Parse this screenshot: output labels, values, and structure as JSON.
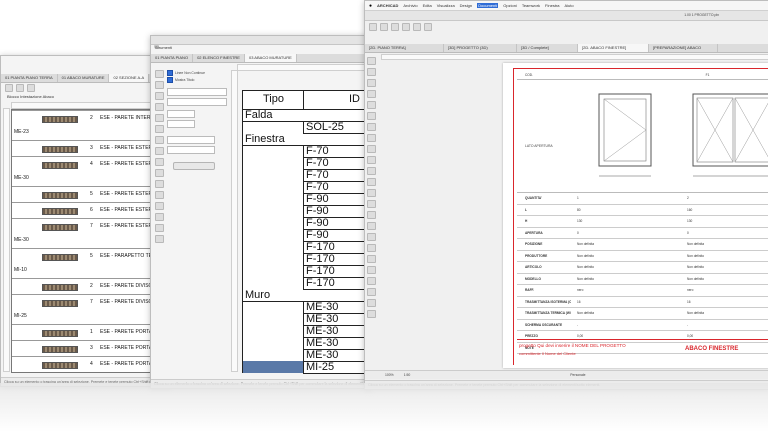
{
  "left_window": {
    "tabs": [
      "01 PIANTA PIANO TERRA",
      "01 ABACO MURATURE",
      "02 SEZIONE A-A"
    ],
    "panel_title": "Blocco Intestazione Abaco",
    "groups": [
      {
        "code": "",
        "rows": [
          {
            "num": "2",
            "text": "ESE - PARETE INTERI"
          }
        ]
      },
      {
        "code": "ME-23",
        "rows": [
          {
            "num": "3",
            "text": "ESE - PARETE ESTER"
          },
          {
            "num": "4",
            "text": "ESE - PARETE ESTER"
          }
        ]
      },
      {
        "code": "ME-30",
        "rows": [
          {
            "num": "5",
            "text": "ESE - PARETE ESTER"
          },
          {
            "num": "6",
            "text": "ESE - PARETE ESTER"
          },
          {
            "num": "7",
            "text": "ESE - PARETE ESTER"
          }
        ]
      },
      {
        "code": "ME-30",
        "rows": [
          {
            "num": "5",
            "text": "ESE - PARAPETTO TE"
          }
        ]
      },
      {
        "code": "MI-10",
        "rows": [
          {
            "num": "2",
            "text": "ESE - PARETE DIVISO"
          },
          {
            "num": "7",
            "text": "ESE - PARETE DIVISO"
          }
        ]
      },
      {
        "code": "MI-25",
        "rows": [
          {
            "num": "1",
            "text": "ESE - PARETE PORTA"
          },
          {
            "num": "3",
            "text": "ESE - PARETE PORTA"
          },
          {
            "num": "4",
            "text": "ESE - PARETE PORTA"
          }
        ]
      }
    ],
    "status": "Clicca su un elemento o trascina un'area di selezione. Premete e tenete premuto Ctrl+Shift per commutare la selezione di elementi/sotto elementi."
  },
  "middle_window": {
    "tabs": [
      "01 PIANTA PIANO",
      "02 ELENCO FINESTRE",
      "03 ABACO MURATURE"
    ],
    "panel_label": "Strumenti",
    "options": [
      "Linee Non Continue",
      "Mostra Titolo"
    ],
    "zoom_value": "70%",
    "schedule_header": [
      "Tipo",
      "ID"
    ],
    "schedule": [
      {
        "tipo": "Falda",
        "ids": [
          "SOL-25"
        ]
      },
      {
        "tipo": "Finestra",
        "ids": [
          "F-70",
          "F-70",
          "F-70",
          "F-70",
          "F-90",
          "F-90",
          "F-90",
          "F-90",
          "F-170",
          "F-170",
          "F-170",
          "F-170"
        ]
      },
      {
        "tipo": "Muro",
        "ids": [
          "ME-30",
          "ME-30",
          "ME-30",
          "ME-30",
          "ME-30",
          "MI-25"
        ]
      }
    ],
    "status": "Clicca su un elemento o trascina un'area di selezione. Premete e tenete premuto Ctrl+Shift per commutare la selezione di elementi/sotto elementi."
  },
  "right_window": {
    "menubar": [
      "ARCHICAD",
      "Archivio",
      "Edita",
      "Visualizza",
      "Design",
      "Documenti",
      "Opzioni",
      "Teamwork",
      "Finestra",
      "Aiuto"
    ],
    "title": "1.00 1 PROGETTO.pln",
    "tabs": [
      "[2D. PIANO TERRA]",
      "[3D] PROGETTO (3D)",
      "[3D / Complete]",
      "[2D. ABACO FINESTRE]",
      "[PREPARAZIONE] ABACO"
    ],
    "sheet": {
      "col_header": [
        "COD.",
        "F1"
      ],
      "image_label": "LATO APERTURA",
      "rows": [
        {
          "label": "QUANTITA'",
          "v1": "1",
          "v2": "2"
        },
        {
          "label": "L",
          "v1": "80",
          "v2": "160"
        },
        {
          "label": "H",
          "v1": "130",
          "v2": "130"
        },
        {
          "label": "APERTURA",
          "v1": "0",
          "v2": "0"
        },
        {
          "label": "POSIZIONE",
          "v1": "Non definita",
          "v2": "Non definita"
        },
        {
          "label": "PRODUTTORE",
          "v1": "Non definito",
          "v2": "Non definito"
        },
        {
          "label": "ARTICOLO",
          "v1": "Non definito",
          "v2": "Non definito"
        },
        {
          "label": "MODELLO",
          "v1": "Non definito",
          "v2": "Non definito"
        },
        {
          "label": "RAFF.",
          "v1": "nero",
          "v2": "nero"
        },
        {
          "label": "TRASMITTANZA ISOTERMA (CLASSE)",
          "v1": "16",
          "v2": "16"
        },
        {
          "label": "TRASMITTANZA TERMICA (W/MQK)",
          "v1": "Non definita",
          "v2": "Non definita"
        },
        {
          "label": "SCHERMA OSCURANTE",
          "v1": "-",
          "v2": "-"
        },
        {
          "label": "PREZZO",
          "v1": "0,00",
          "v2": "0,00"
        },
        {
          "label": "NOTE",
          "v1": "",
          "v2": ""
        }
      ],
      "footer_project": "progetto Qui devi inserire il NOME DEL PROGETTO",
      "footer_client": "committente Il Nome del Cliente",
      "footer_title": "ABACO FINESTRE"
    },
    "navbar": {
      "zoom": "100%",
      "scale": "1:50",
      "mode": "Personale"
    },
    "status": "Clicca su un elemento o trascina un'area di selezione. Premete e tenete premuto Ctrl+Shift per commutare la selezione di elementi/sotto elementi."
  },
  "colors": {
    "accent_blue": "#2f6cd6",
    "selection": "#5a79a8",
    "red_frame": "#d9262c"
  }
}
